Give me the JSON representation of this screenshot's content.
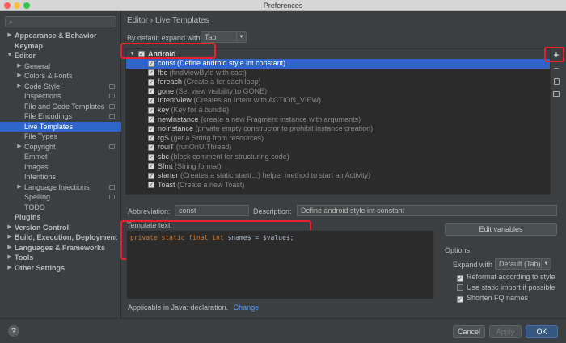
{
  "window": {
    "title": "Preferences"
  },
  "sidebar": {
    "search_placeholder": "",
    "items": [
      {
        "label": "Appearance & Behavior",
        "level": 0,
        "arrow": "▶",
        "bold": true
      },
      {
        "label": "Keymap",
        "level": 0,
        "arrow": "",
        "bold": true
      },
      {
        "label": "Editor",
        "level": 0,
        "arrow": "▼",
        "bold": true
      },
      {
        "label": "General",
        "level": 1,
        "arrow": "▶"
      },
      {
        "label": "Colors & Fonts",
        "level": 1,
        "arrow": "▶"
      },
      {
        "label": "Code Style",
        "level": 1,
        "arrow": "▶",
        "proj": true
      },
      {
        "label": "Inspections",
        "level": 1,
        "arrow": "",
        "proj": true
      },
      {
        "label": "File and Code Templates",
        "level": 1,
        "arrow": "",
        "proj": true
      },
      {
        "label": "File Encodings",
        "level": 1,
        "arrow": "",
        "proj": true
      },
      {
        "label": "Live Templates",
        "level": 1,
        "arrow": "",
        "selected": true
      },
      {
        "label": "File Types",
        "level": 1,
        "arrow": ""
      },
      {
        "label": "Copyright",
        "level": 1,
        "arrow": "▶",
        "proj": true
      },
      {
        "label": "Emmet",
        "level": 1,
        "arrow": ""
      },
      {
        "label": "Images",
        "level": 1,
        "arrow": ""
      },
      {
        "label": "Intentions",
        "level": 1,
        "arrow": ""
      },
      {
        "label": "Language Injections",
        "level": 1,
        "arrow": "▶",
        "proj": true
      },
      {
        "label": "Spelling",
        "level": 1,
        "arrow": "",
        "proj": true
      },
      {
        "label": "TODO",
        "level": 1,
        "arrow": ""
      },
      {
        "label": "Plugins",
        "level": 0,
        "arrow": "",
        "bold": true
      },
      {
        "label": "Version Control",
        "level": 0,
        "arrow": "▶",
        "bold": true
      },
      {
        "label": "Build, Execution, Deployment",
        "level": 0,
        "arrow": "▶",
        "bold": true
      },
      {
        "label": "Languages & Frameworks",
        "level": 0,
        "arrow": "▶",
        "bold": true
      },
      {
        "label": "Tools",
        "level": 0,
        "arrow": "▶",
        "bold": true
      },
      {
        "label": "Other Settings",
        "level": 0,
        "arrow": "▶",
        "bold": true
      }
    ]
  },
  "main": {
    "breadcrumb": "Editor › Live Templates",
    "expand_label": "By default expand with",
    "expand_value": "Tab",
    "group_name": "Android",
    "templates": [
      {
        "abbr": "const",
        "desc": "(Define android style int constant)",
        "selected": true
      },
      {
        "abbr": "fbc",
        "desc": "(findViewById with cast)"
      },
      {
        "abbr": "foreach",
        "desc": "(Create a for each loop)"
      },
      {
        "abbr": "gone",
        "desc": "(Set view visibility to GONE)"
      },
      {
        "abbr": "IntentView",
        "desc": "(Creates an Intent with ACTION_VIEW)"
      },
      {
        "abbr": "key",
        "desc": "(Key for a bundle)"
      },
      {
        "abbr": "newInstance",
        "desc": "(create a new Fragment instance with arguments)"
      },
      {
        "abbr": "noInstance",
        "desc": "(private empty constructor to prohibit instance creation)"
      },
      {
        "abbr": "rgS",
        "desc": "(get a String from resources)"
      },
      {
        "abbr": "rouiT",
        "desc": "(runOnUIThread)"
      },
      {
        "abbr": "sbc",
        "desc": "(block comment for structuring code)"
      },
      {
        "abbr": "Sfmt",
        "desc": "(String format)"
      },
      {
        "abbr": "starter",
        "desc": "(Creates a static start(...) helper method to start an Activity)"
      },
      {
        "abbr": "Toast",
        "desc": "(Create a new Toast)"
      }
    ],
    "abbreviation_label": "Abbreviation:",
    "abbreviation_value": "const",
    "description_label": "Description:",
    "description_value": "Define android style int constant",
    "template_text_label": "Template text:",
    "code": {
      "kw1": "private",
      "kw2": "static",
      "kw3": "final",
      "kw4": "int",
      "var1": "$name$",
      "eq": "=",
      "var2": "$value$",
      "end": ";"
    },
    "edit_variables_label": "Edit variables",
    "options_label": "Options",
    "expand_with_label": "Expand with",
    "expand_with_value": "Default (Tab)",
    "options": [
      {
        "label": "Reformat according to style",
        "checked": true
      },
      {
        "label": "Use static import if possible",
        "checked": false
      },
      {
        "label": "Shorten FQ names",
        "checked": true
      }
    ],
    "applicable_label": "Applicable in Java: declaration.",
    "change_link": "Change"
  },
  "footer": {
    "help": "?",
    "cancel": "Cancel",
    "apply": "Apply",
    "ok": "OK"
  },
  "colors": {
    "selection": "#2f65ca",
    "highlight_box": "#e8212d",
    "keyword": "#cc7832",
    "link": "#589df6"
  },
  "icons": {
    "check": "✓",
    "add": "+",
    "remove": "−"
  }
}
